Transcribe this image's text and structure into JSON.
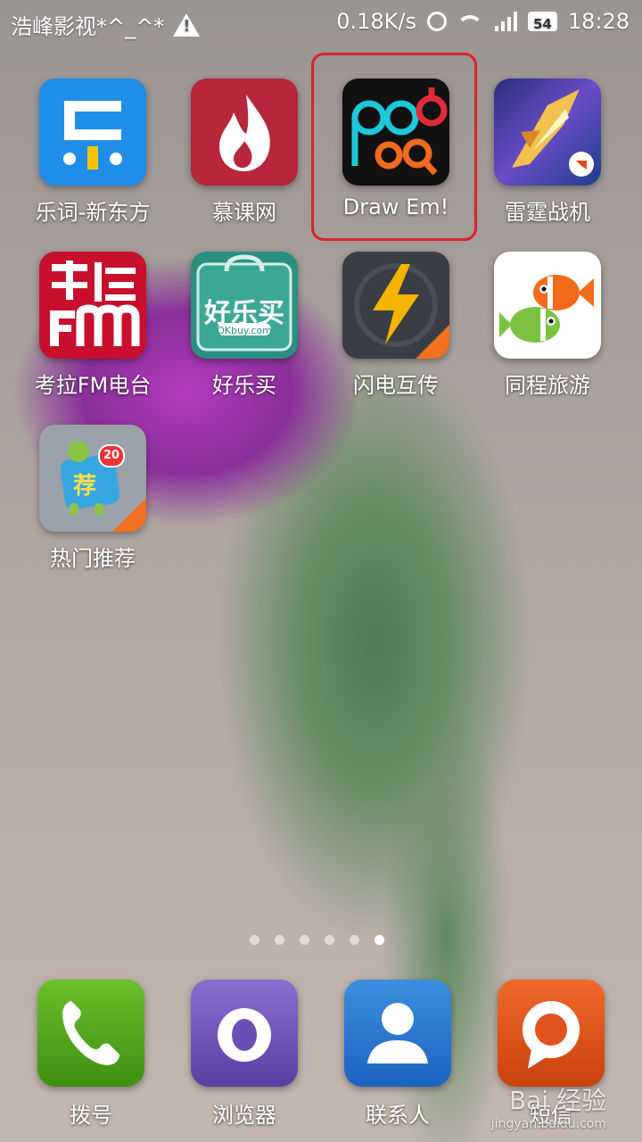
{
  "status_bar": {
    "carrier": "浩峰影视*^_^*",
    "speed": "0.18K/s",
    "battery": "54",
    "time": "18:28"
  },
  "apps": [
    {
      "label": "乐词-新东方",
      "icon": "leci-icon",
      "color": "#1e8ee8"
    },
    {
      "label": "慕课网",
      "icon": "flame-icon",
      "color": "#b7263a"
    },
    {
      "label": "Draw Em!",
      "icon": "draw-em-icon",
      "color": "#111111"
    },
    {
      "label": "雷霆战机",
      "icon": "fighter-jet-icon",
      "color": "#3b4aa0"
    },
    {
      "label": "考拉FM电台",
      "icon": "koala-fm-icon",
      "color": "#c8102e"
    },
    {
      "label": "好乐买",
      "icon": "shopping-bag-icon",
      "color": "#2a8f7f"
    },
    {
      "label": "闪电互传",
      "icon": "lightning-icon",
      "color": "#3a3d44"
    },
    {
      "label": "同程旅游",
      "icon": "fish-icon",
      "color": "#ffffff"
    },
    {
      "label": "热门推荐",
      "icon": "recommend-icon",
      "color": "#9aa1a8",
      "badge": "20"
    }
  ],
  "page_dots": {
    "count": 6,
    "active_index": 5
  },
  "dock": [
    {
      "label": "拨号",
      "icon": "phone-icon",
      "color": "#4e9e1a"
    },
    {
      "label": "浏览器",
      "icon": "browser-icon",
      "color": "#6b4fb5"
    },
    {
      "label": "联系人",
      "icon": "contact-icon",
      "color": "#2576cf"
    },
    {
      "label": "短信",
      "icon": "message-icon",
      "color": "#e0521f"
    }
  ],
  "watermark": {
    "line1": "Bai 经验",
    "line2": "jingyan.baidu.com"
  }
}
